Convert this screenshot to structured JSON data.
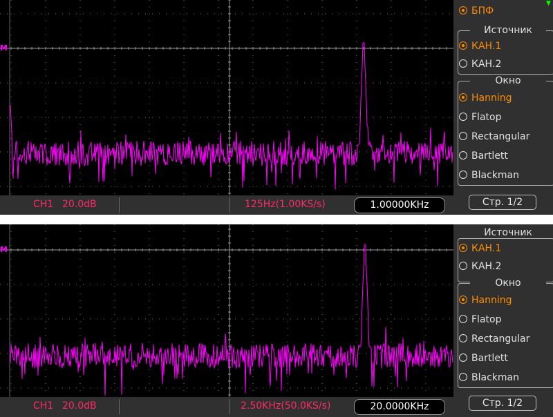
{
  "top": {
    "status": {
      "channel": "CH1",
      "scale": "20.0dB",
      "span": "125Hz(1.00KS/s)",
      "freq": "1.00000KHz"
    },
    "menu": {
      "fft_label": "БПФ",
      "source_title": "Источник",
      "source_items": [
        "КАН.1",
        "КАН.2"
      ],
      "window_title": "Окно",
      "window_items": [
        "Hanning",
        "Flatop",
        "Rectangular",
        "Bartlett",
        "Blackman"
      ],
      "page": "Стр.  1/2"
    }
  },
  "bottom": {
    "status": {
      "channel": "CH1",
      "scale": "20.0dB",
      "span": "2.50KHz(50.0KS/s)",
      "freq": "20.0000KHz"
    },
    "menu": {
      "source_title": "Источник",
      "source_items": [
        "КАН.1",
        "КАН.2"
      ],
      "window_title": "Окно",
      "window_items": [
        "Hanning",
        "Flatop",
        "Rectangular",
        "Bartlett",
        "Blackman"
      ],
      "page": "Стр.  1/2"
    }
  },
  "marker_label": "M",
  "colors": {
    "trace": "#ff00ff",
    "status_text": "#ff2a6a",
    "selected": "#ff8c00",
    "grid": "#777777"
  }
}
